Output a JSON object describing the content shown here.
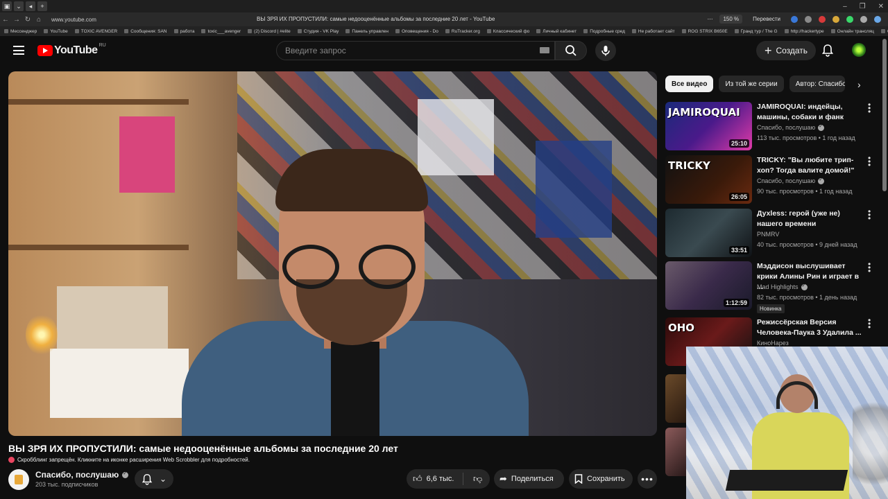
{
  "browser": {
    "url": "www.youtube.com",
    "page_title": "ВЫ ЗРЯ ИХ ПРОПУСТИЛИ: самые недооценённые альбомы за последние 20 лет - YouTube",
    "zoom": "150 %",
    "translate": "Перевести",
    "bookmarks": [
      "Мессенджер",
      "YouTube",
      "TOXIC AVENGER",
      "Сообщения: SAN",
      "работа",
      "toxic___avenger",
      "(2) Discord | #elite",
      "Студия - VK Play",
      "Панель управлен",
      "Оповещения - Do",
      "RuTracker.org",
      "Классический фо",
      "Личный кабинет",
      "Подробные сред",
      "Не работает сайт",
      "ROG STRIX B650E",
      "Гранд тур / The G",
      "http://hackertype",
      "Онлайн трансляц",
      "Ос"
    ]
  },
  "header": {
    "logo_text": "YouTube",
    "region": "RU",
    "search_placeholder": "Введите запрос",
    "create_label": "Создать"
  },
  "video": {
    "title": "ВЫ ЗРЯ ИХ ПРОПУСТИЛИ: самые недооценённые альбомы за последние 20 лет",
    "scrobbler_notice": "Скробблинг запрещён. Кликните на иконке расширения Web Scrobbler для подробностей.",
    "channel_name": "Спасибо, послушаю",
    "subscribers": "203 тыс. подписчиков",
    "likes": "6,6 тыс.",
    "share_label": "Поделиться",
    "save_label": "Сохранить"
  },
  "chips": [
    "Все видео",
    "Из той же серии",
    "Автор: Спасибо"
  ],
  "recommendations": [
    {
      "title": "JAMIROQUAI: индейцы, машины, собаки и фанк",
      "channel": "Спасибо, послушаю",
      "verified": true,
      "meta": "113 тыс. просмотров • 1 год назад",
      "duration": "25:10",
      "thumb_text": "JAMIROQUAI"
    },
    {
      "title": "TRICKY: \"Вы любите трип-хоп? Тогда валите домой!\"",
      "channel": "Спасибо, послушаю",
      "verified": true,
      "meta": "90 тыс. просмотров • 1 год назад",
      "duration": "26:05",
      "thumb_text": "TRICKY"
    },
    {
      "title": "Духless: герой (уже не) нашего времени",
      "channel": "PNMRV",
      "verified": false,
      "meta": "40 тыс. просмотров • 9 дней назад",
      "duration": "33:51",
      "thumb_text": ""
    },
    {
      "title": "Мэддисон выслушивает крики Алины Рин и играет в ...",
      "channel": "Mad Highlights",
      "verified": true,
      "meta": "82 тыс. просмотров • 1 день назад",
      "duration": "1:12:59",
      "thumb_text": "",
      "badge": "Новинка"
    },
    {
      "title": "Режиссёрская Версия Человека-Паука 3 Удалила ...",
      "channel": "КиноНарез",
      "verified": false,
      "meta": "",
      "duration": "",
      "thumb_text": "ОНО"
    }
  ]
}
